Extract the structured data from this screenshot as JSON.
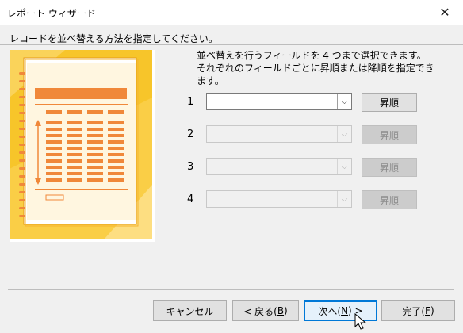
{
  "window": {
    "title": "レポート ウィザード",
    "close_glyph": "✕"
  },
  "instruction": "レコードを並べ替える方法を指定してください。",
  "description": "並べ替えを行うフィールドを 4 つまで選択できます。それぞれのフィールドごとに昇順または降順を指定できます。",
  "sort_rows": [
    {
      "number": "1",
      "field_value": "",
      "order_label": "昇順",
      "enabled": true
    },
    {
      "number": "2",
      "field_value": "",
      "order_label": "昇順",
      "enabled": false
    },
    {
      "number": "3",
      "field_value": "",
      "order_label": "昇順",
      "enabled": false
    },
    {
      "number": "4",
      "field_value": "",
      "order_label": "昇順",
      "enabled": false
    }
  ],
  "buttons": {
    "cancel": "キャンセル",
    "back_pre": "< 戻る(",
    "back_key": "B",
    "back_post": ")",
    "next_pre": "次へ(",
    "next_key": "N",
    "next_post": ") >",
    "finish_pre": "完了(",
    "finish_key": "F",
    "finish_post": ")"
  },
  "colors": {
    "accent": "#0078d7",
    "illustration": "#fbc02d",
    "illustration_accent": "#f0883a"
  }
}
